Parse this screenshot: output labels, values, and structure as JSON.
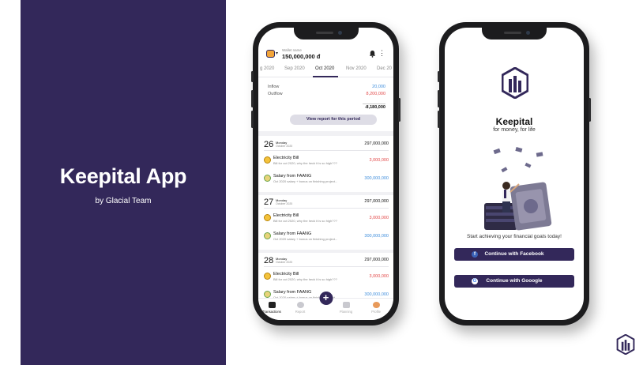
{
  "hero": {
    "title": "Keepital App",
    "subtitle": "by Glacial Team"
  },
  "transactions_screen": {
    "wallet_label": "Wallet name",
    "wallet_amount": "150,000,000 đ",
    "icons": [
      "bell-icon",
      "more-vert-icon"
    ],
    "tabs": [
      "g 2020",
      "Sep 2020",
      "Oct 2020",
      "Nov 2020",
      "Dec 20"
    ],
    "active_tab": "Oct 2020",
    "summary": {
      "inflow_label": "Inflow",
      "inflow": "20,000",
      "outflow_label": "Outflow",
      "outflow": "8,200,000",
      "net": "-8,180,000"
    },
    "report_button": "View report for this period",
    "days": [
      {
        "day": "26",
        "weekday": "Monday",
        "month": "October 2020",
        "total": "297,000,000",
        "items": [
          {
            "name": "Electricity Bill",
            "note": "Bill for oct 2020, why the heck it is so high???",
            "amount": "3,000,000",
            "type": "out",
            "icon": "lightbulb-icon"
          },
          {
            "name": "Salary from FAANG",
            "note": "Oct 2020 salary + bonus on finishing project...",
            "amount": "300,000,000",
            "type": "in",
            "icon": "money-icon"
          }
        ]
      },
      {
        "day": "27",
        "weekday": "Monday",
        "month": "October 2020",
        "total": "297,000,000",
        "items": [
          {
            "name": "Electricity Bill",
            "note": "Bill for oct 2020, why the heck it is so high???",
            "amount": "3,000,000",
            "type": "out",
            "icon": "lightbulb-icon"
          },
          {
            "name": "Salary from FAANG",
            "note": "Oct 2020 salary + bonus on finishing project...",
            "amount": "300,000,000",
            "type": "in",
            "icon": "money-icon"
          }
        ]
      },
      {
        "day": "28",
        "weekday": "Monday",
        "month": "October 2020",
        "total": "297,000,000",
        "items": [
          {
            "name": "Electricity Bill",
            "note": "Bill for oct 2020, why the heck it is so high???",
            "amount": "3,000,000",
            "type": "out",
            "icon": "lightbulb-icon"
          },
          {
            "name": "Salary from FAANG",
            "note": "Oct 2020 salary + bonus on finishing project...",
            "amount": "300,000,000",
            "type": "in",
            "icon": "money-icon"
          }
        ]
      }
    ],
    "nav": [
      {
        "label": "Transactions",
        "icon": "wallet-icon",
        "active": true
      },
      {
        "label": "Report",
        "icon": "pie-chart-icon",
        "active": false
      },
      {
        "label": "Planning",
        "icon": "calendar-icon",
        "active": false
      },
      {
        "label": "Profile",
        "icon": "profile-icon",
        "active": false
      }
    ],
    "fab_label": "+"
  },
  "login_screen": {
    "brand": "Keepital",
    "tagline": "for money, for life",
    "cta": "Start achieving your financial goals today!",
    "facebook_button": "Continue with Facebook",
    "google_button": "Continue with Gooogle",
    "facebook_icon_glyph": "f",
    "google_icon_glyph": "G"
  },
  "colors": {
    "brand": "#33285a",
    "inflow": "#3f8edc",
    "outflow": "#e24747"
  }
}
